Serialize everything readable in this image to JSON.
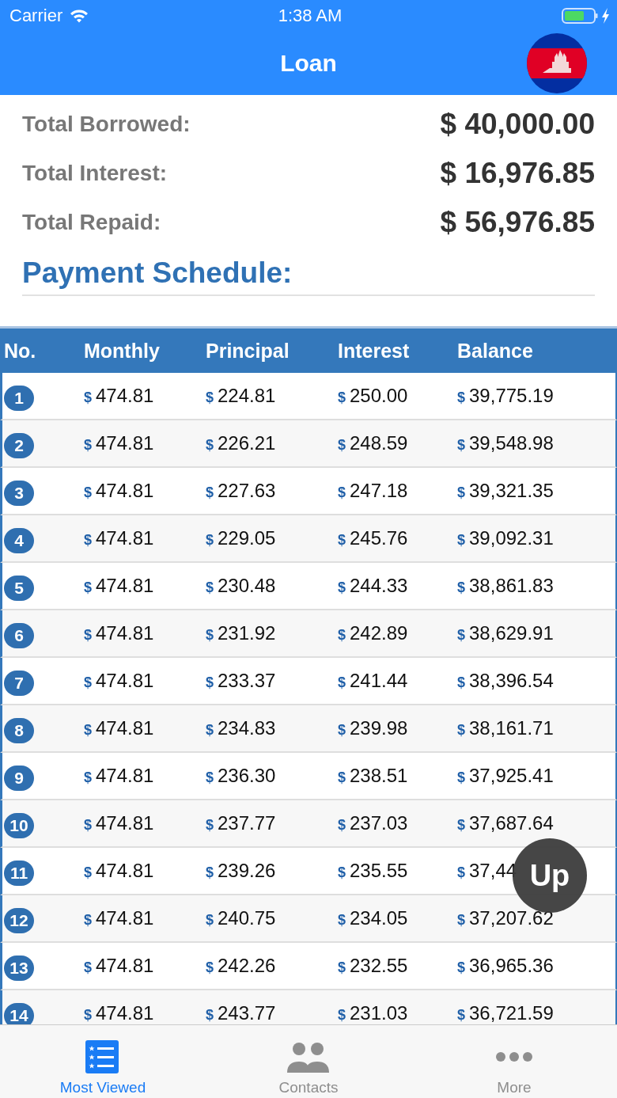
{
  "status_bar": {
    "carrier": "Carrier",
    "time": "1:38 AM"
  },
  "nav_bar": {
    "title": "Loan"
  },
  "summary": [
    {
      "label": "Total Borrowed:",
      "value": "$ 40,000.00"
    },
    {
      "label": "Total Interest:",
      "value": "$ 16,976.85"
    },
    {
      "label": "Total Repaid:",
      "value": "$ 56,976.85"
    }
  ],
  "section_title": "Payment Schedule:",
  "table": {
    "columns": [
      "No.",
      "Monthly",
      "Principal",
      "Interest",
      "Balance"
    ],
    "currency": "$",
    "rows": [
      [
        "1",
        "474.81",
        "224.81",
        "250.00",
        "39,775.19"
      ],
      [
        "2",
        "474.81",
        "226.21",
        "248.59",
        "39,548.98"
      ],
      [
        "3",
        "474.81",
        "227.63",
        "247.18",
        "39,321.35"
      ],
      [
        "4",
        "474.81",
        "229.05",
        "245.76",
        "39,092.31"
      ],
      [
        "5",
        "474.81",
        "230.48",
        "244.33",
        "38,861.83"
      ],
      [
        "6",
        "474.81",
        "231.92",
        "242.89",
        "38,629.91"
      ],
      [
        "7",
        "474.81",
        "233.37",
        "241.44",
        "38,396.54"
      ],
      [
        "8",
        "474.81",
        "234.83",
        "239.98",
        "38,161.71"
      ],
      [
        "9",
        "474.81",
        "236.30",
        "238.51",
        "37,925.41"
      ],
      [
        "10",
        "474.81",
        "237.77",
        "237.03",
        "37,687.64"
      ],
      [
        "11",
        "474.81",
        "239.26",
        "235.55",
        "37,44"
      ],
      [
        "12",
        "474.81",
        "240.75",
        "234.05",
        "37,207.62"
      ],
      [
        "13",
        "474.81",
        "242.26",
        "232.55",
        "36,965.36"
      ],
      [
        "14",
        "474.81",
        "243.77",
        "231.03",
        "36,721.59"
      ]
    ]
  },
  "up_button": {
    "label": "Up"
  },
  "tab_bar": [
    {
      "kind": "list",
      "label": "Most Viewed",
      "selected": true
    },
    {
      "kind": "contacts",
      "label": "Contacts",
      "selected": false
    },
    {
      "kind": "more",
      "label": "More",
      "selected": false
    }
  ]
}
